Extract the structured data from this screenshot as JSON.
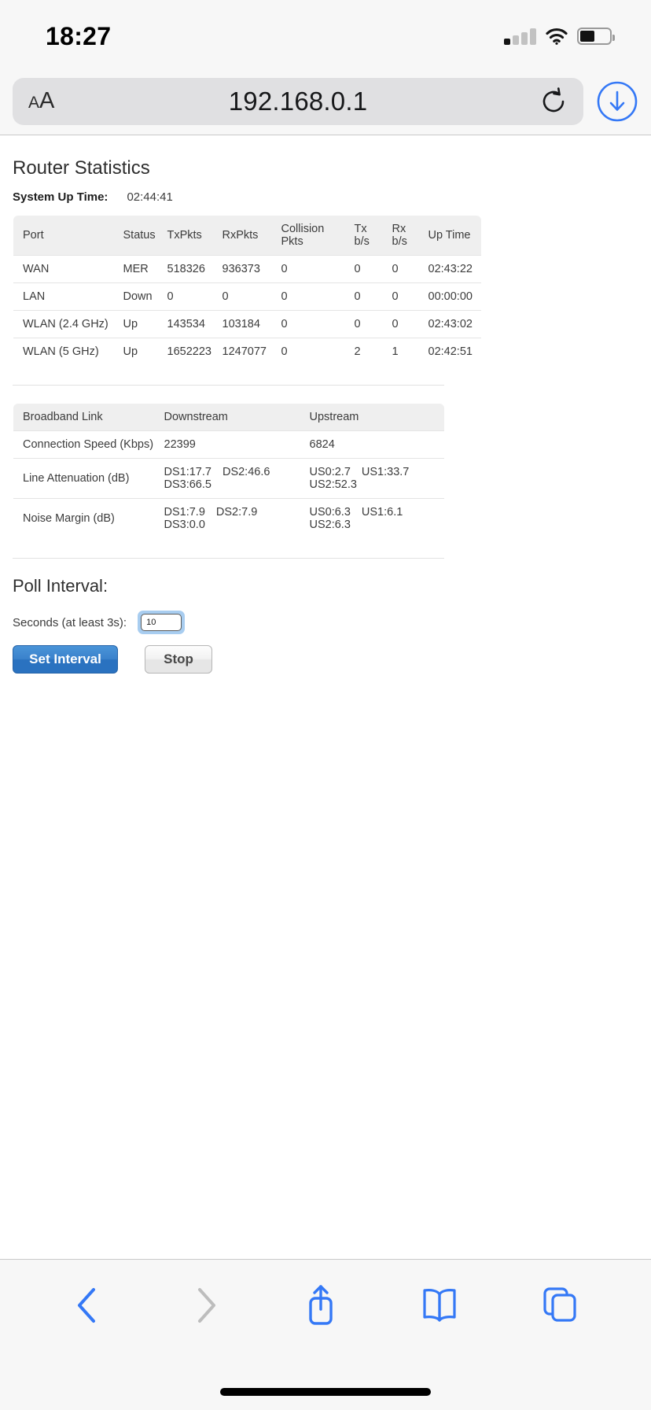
{
  "status_bar": {
    "time": "18:27",
    "cellular_icon": "cellular-signal-icon",
    "wifi_icon": "wifi-icon",
    "battery_icon": "battery-icon",
    "battery_level_pct": 50,
    "signal_bars_active": 1,
    "signal_bars_total": 4
  },
  "browser": {
    "text_size_label": "AA",
    "url": "192.168.0.1",
    "reload_icon": "reload-icon",
    "download_icon": "download-icon",
    "toolbar": {
      "back_icon": "back-chevron-icon",
      "forward_icon": "forward-chevron-icon",
      "share_icon": "share-icon",
      "bookmarks_icon": "bookmarks-icon",
      "tabs_icon": "tabs-icon"
    }
  },
  "page": {
    "title": "Router Statistics",
    "system_up_time": {
      "label": "System Up Time:",
      "value": "02:44:41"
    },
    "stats_table": {
      "headers": [
        "Port",
        "Status",
        "TxPkts",
        "RxPkts",
        "Collision Pkts",
        "Tx b/s",
        "Rx b/s",
        "Up Time"
      ],
      "rows": [
        {
          "port": "WAN",
          "status": "MER",
          "tx_pkts": "518326",
          "rx_pkts": "936373",
          "collision_pkts": "0",
          "tx_bs": "0",
          "rx_bs": "0",
          "up_time": "02:43:22",
          "highlight": false
        },
        {
          "port": "LAN",
          "status": "Down",
          "tx_pkts": "0",
          "rx_pkts": "0",
          "collision_pkts": "0",
          "tx_bs": "0",
          "rx_bs": "0",
          "up_time": "00:00:00",
          "highlight": false
        },
        {
          "port": "WLAN (2.4 GHz)",
          "status": "Up",
          "tx_pkts": "143534",
          "rx_pkts": "103184",
          "collision_pkts": "0",
          "tx_bs": "0",
          "rx_bs": "0",
          "up_time": "02:43:02",
          "highlight": false
        },
        {
          "port": "WLAN (5 GHz)",
          "status": "Up",
          "tx_pkts": "1652223",
          "rx_pkts": "1247077",
          "collision_pkts": "0",
          "tx_bs": "2",
          "rx_bs": "1",
          "up_time": "02:42:51",
          "highlight": true
        }
      ]
    },
    "broadband_table": {
      "headers": [
        "Broadband Link",
        "Downstream",
        "Upstream"
      ],
      "rows": [
        {
          "label": "Connection Speed (Kbps)",
          "downstream": [
            "22399"
          ],
          "upstream": [
            "6824"
          ]
        },
        {
          "label": "Line Attenuation (dB)",
          "downstream": [
            "DS1:17.7",
            "DS2:46.6",
            "DS3:66.5"
          ],
          "upstream": [
            "US0:2.7",
            "US1:33.7",
            "US2:52.3"
          ]
        },
        {
          "label": "Noise Margin (dB)",
          "downstream": [
            "DS1:7.9",
            "DS2:7.9",
            "DS3:0.0"
          ],
          "upstream": [
            "US0:6.3",
            "US1:6.1",
            "US2:6.3"
          ]
        }
      ]
    },
    "poll_interval": {
      "heading": "Poll Interval:",
      "seconds_label": "Seconds (at least 3s):",
      "seconds_value": "10",
      "seconds_placeholder": "10",
      "set_button": "Set Interval",
      "stop_button": "Stop"
    }
  },
  "colors": {
    "link_blue": "#1f51e0",
    "accent_blue": "#2a72c0",
    "ios_blue": "#3478f6",
    "table_header_bg": "#efefef"
  }
}
